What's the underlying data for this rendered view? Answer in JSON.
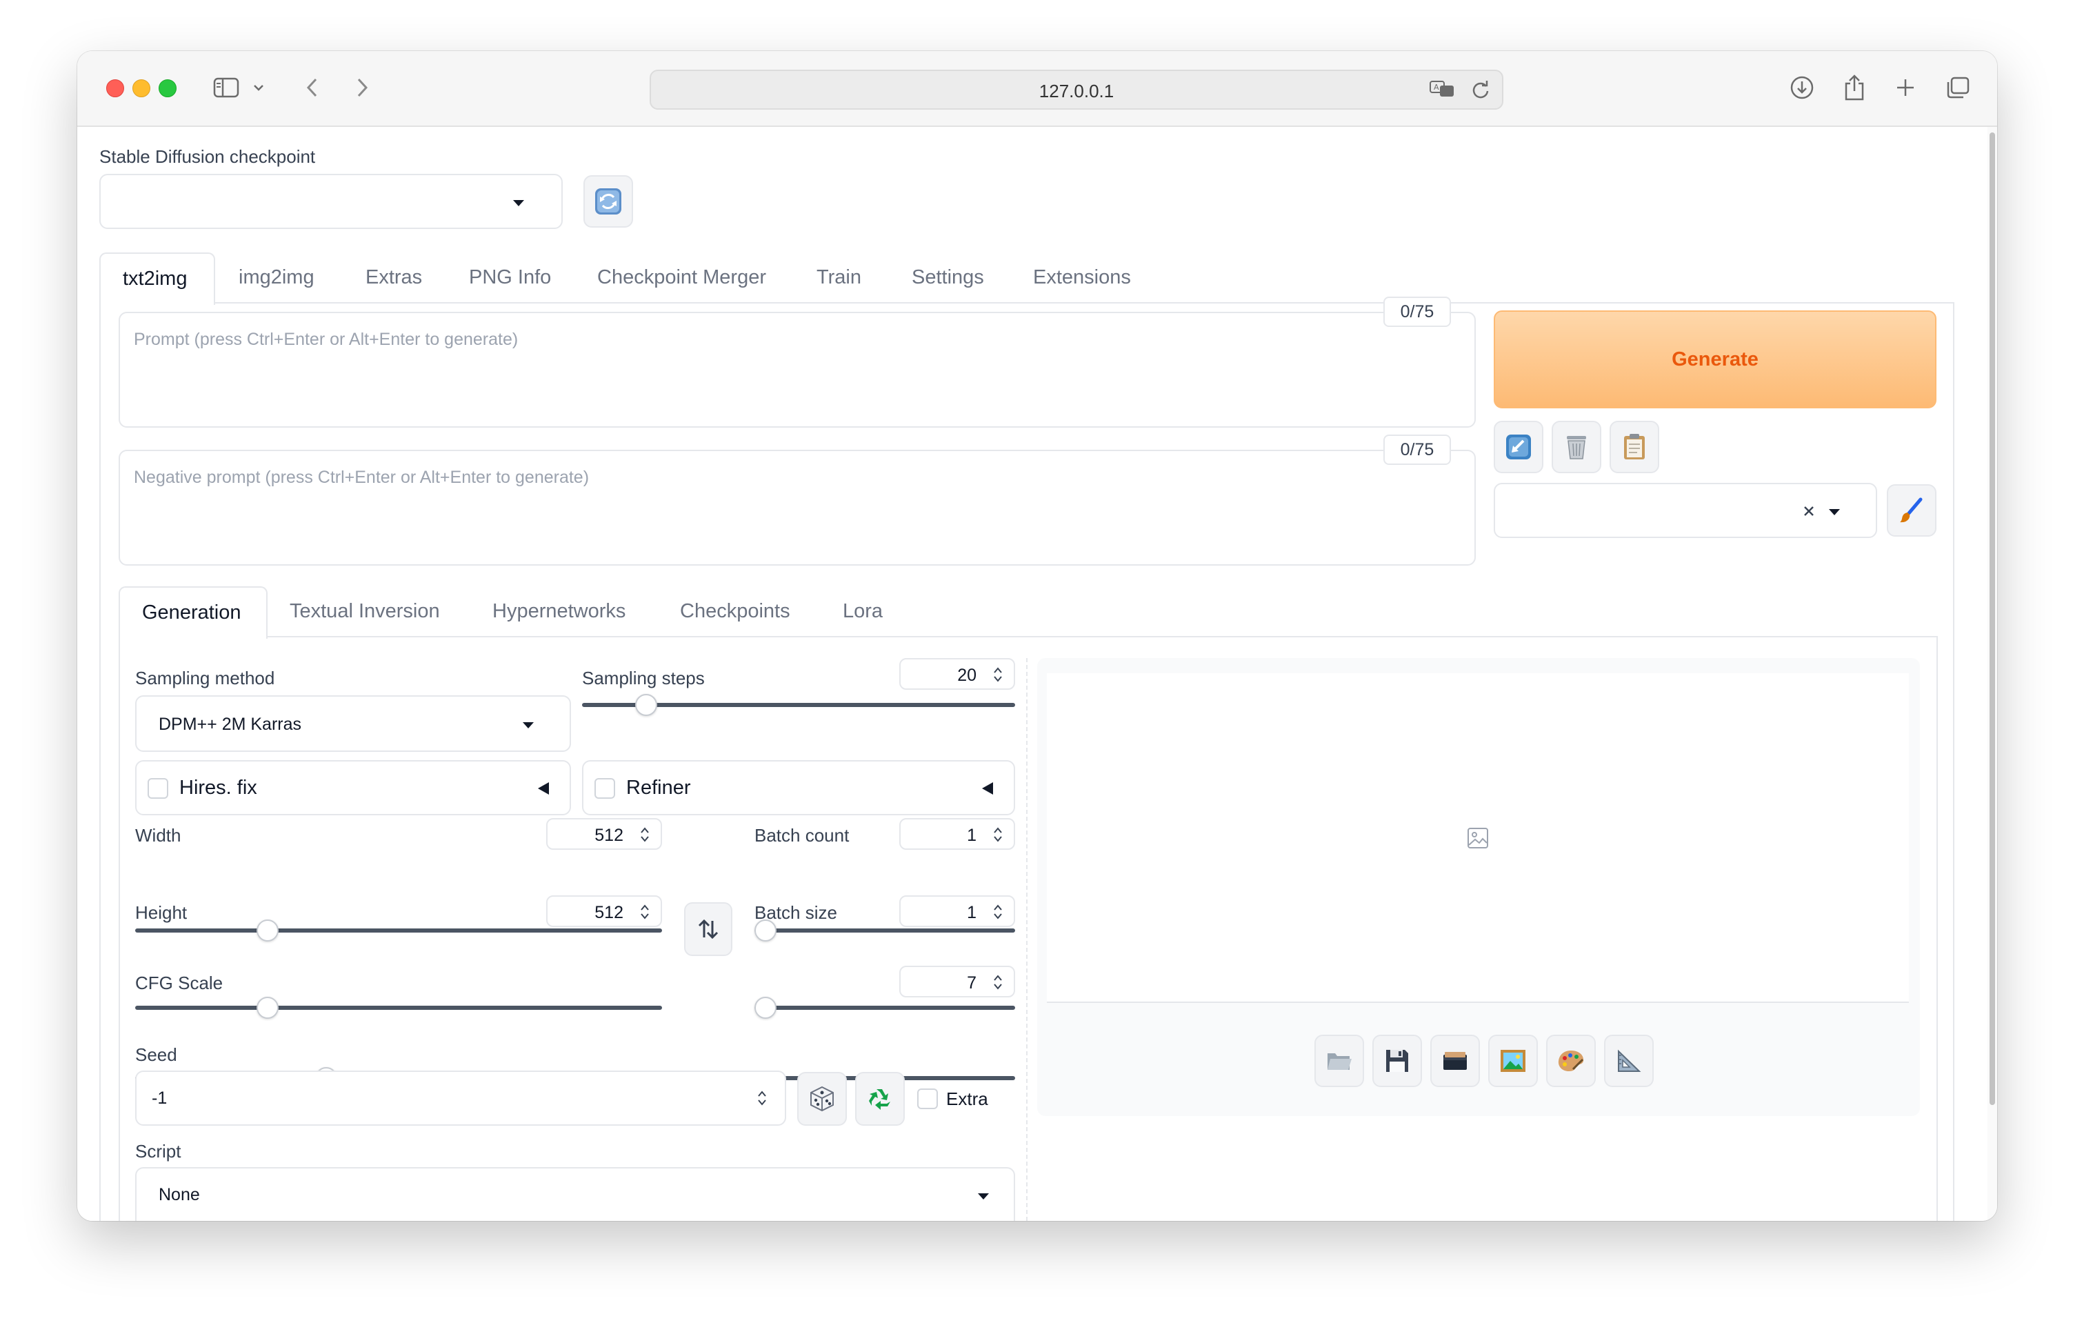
{
  "browser": {
    "url": "127.0.0.1"
  },
  "checkpoint": {
    "label": "Stable Diffusion checkpoint",
    "value": ""
  },
  "main_tabs": [
    {
      "label": "txt2img",
      "active": true
    },
    {
      "label": "img2img"
    },
    {
      "label": "Extras"
    },
    {
      "label": "PNG Info"
    },
    {
      "label": "Checkpoint Merger"
    },
    {
      "label": "Train"
    },
    {
      "label": "Settings"
    },
    {
      "label": "Extensions"
    }
  ],
  "prompt": {
    "placeholder": "Prompt (press Ctrl+Enter or Alt+Enter to generate)",
    "value": "",
    "counter": "0/75"
  },
  "negative_prompt": {
    "placeholder": "Negative prompt (press Ctrl+Enter or Alt+Enter to generate)",
    "value": "",
    "counter": "0/75"
  },
  "generate_label": "Generate",
  "styles_value": "",
  "sub_tabs": [
    {
      "label": "Generation",
      "active": true
    },
    {
      "label": "Textual Inversion"
    },
    {
      "label": "Hypernetworks"
    },
    {
      "label": "Checkpoints"
    },
    {
      "label": "Lora"
    }
  ],
  "generation": {
    "sampling_method": {
      "label": "Sampling method",
      "value": "DPM++ 2M Karras"
    },
    "sampling_steps": {
      "label": "Sampling steps",
      "value": "20",
      "fraction": 0.13
    },
    "hires_fix": {
      "label": "Hires. fix",
      "checked": false
    },
    "refiner": {
      "label": "Refiner",
      "checked": false
    },
    "width": {
      "label": "Width",
      "value": "512",
      "fraction": 0.24
    },
    "height": {
      "label": "Height",
      "value": "512",
      "fraction": 0.24
    },
    "batch_count": {
      "label": "Batch count",
      "value": "1",
      "fraction": 0.0
    },
    "batch_size": {
      "label": "Batch size",
      "value": "1",
      "fraction": 0.0
    },
    "cfg_scale": {
      "label": "CFG Scale",
      "value": "7",
      "fraction": 0.21
    },
    "seed": {
      "label": "Seed",
      "value": "-1",
      "extra_label": "Extra"
    },
    "script": {
      "label": "Script",
      "value": "None"
    }
  },
  "output_tools": [
    "folder-icon",
    "save-icon",
    "zip-icon",
    "image-icon",
    "palette-icon",
    "ruler-icon"
  ],
  "colors": {
    "generate_gradient_start": "#fed7aa",
    "generate_gradient_end": "#fdba74",
    "generate_text": "#ea580c",
    "recycle_green": "#16a34a"
  }
}
